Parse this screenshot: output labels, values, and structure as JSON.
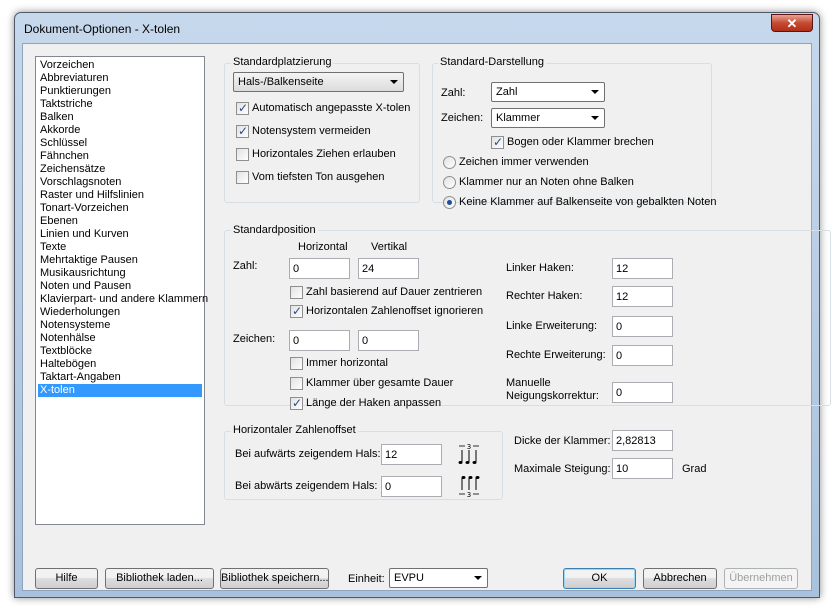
{
  "window": {
    "title": "Dokument-Optionen - X-tolen",
    "close_glyph": "✕"
  },
  "sidebar": {
    "selected": "X-tolen",
    "items": [
      "Vorzeichen",
      "Abbreviaturen",
      "Punktierungen",
      "Taktstriche",
      "Balken",
      "Akkorde",
      "Schlüssel",
      "Fähnchen",
      "Zeichensätze",
      "Vorschlagsnoten",
      "Raster und Hilfslinien",
      "Tonart-Vorzeichen",
      "Ebenen",
      "Linien und Kurven",
      "Texte",
      "Mehrtaktige Pausen",
      "Musikausrichtung",
      "Noten und Pausen",
      "Klavierpart- und andere Klammern",
      "Wiederholungen",
      "Notensysteme",
      "Notenhälse",
      "Textblöcke",
      "Haltebögen",
      "Taktart-Angaben",
      "X-tolen"
    ]
  },
  "standardplatzierung": {
    "label": "Standardplatzierung",
    "dropdown_value": "Hals-/Balkenseite",
    "checks": [
      {
        "label": "Automatisch angepasste X-tolen",
        "checked": true
      },
      {
        "label": "Notensystem vermeiden",
        "checked": true
      },
      {
        "label": "Horizontales Ziehen erlauben",
        "checked": false
      },
      {
        "label": "Vom tiefsten Ton ausgehen",
        "checked": false
      }
    ]
  },
  "standard_darstellung": {
    "label": "Standard-Darstellung",
    "zahl_label": "Zahl:",
    "zahl_value": "Zahl",
    "zeichen_label": "Zeichen:",
    "zeichen_value": "Klammer",
    "bogen_check": {
      "label": "Bogen oder Klammer brechen",
      "checked": true
    },
    "radios": [
      {
        "label": "Zeichen immer verwenden",
        "selected": false
      },
      {
        "label": "Klammer nur an Noten ohne Balken",
        "selected": false
      },
      {
        "label": "Keine Klammer auf Balkenseite von gebalkten Noten",
        "selected": true
      }
    ]
  },
  "standardposition": {
    "label": "Standardposition",
    "col_horizontal": "Horizontal",
    "col_vertikal": "Vertikal",
    "zahl_label": "Zahl:",
    "zahl_h": "0",
    "zahl_v": "24",
    "zahl_checks": [
      {
        "label": "Zahl basierend auf Dauer zentrieren",
        "checked": false
      },
      {
        "label": "Horizontalen Zahlenoffset ignorieren",
        "checked": true
      }
    ],
    "zeichen_label": "Zeichen:",
    "zeichen_h": "0",
    "zeichen_v": "0",
    "zeichen_checks": [
      {
        "label": "Immer horizontal",
        "checked": false
      },
      {
        "label": "Klammer über gesamte Dauer",
        "checked": false
      },
      {
        "label": "Länge der Haken anpassen",
        "checked": true
      }
    ],
    "right_fields": [
      {
        "label": "Linker Haken:",
        "value": "12"
      },
      {
        "label": "Rechter Haken:",
        "value": "12"
      },
      {
        "label": "Linke Erweiterung:",
        "value": "0"
      },
      {
        "label": "Rechte Erweiterung:",
        "value": "0"
      }
    ],
    "neigung_label_1": "Manuelle",
    "neigung_label_2": "Neigungskorrektur:",
    "neigung_value": "0"
  },
  "zahlenoffset": {
    "label": "Horizontaler Zahlenoffset",
    "aufwaerts_label": "Bei aufwärts zeigendem Hals:",
    "aufwaerts_value": "12",
    "abwaerts_label": "Bei abwärts zeigendem Hals:",
    "abwaerts_value": "0"
  },
  "klammer": {
    "dicke_label": "Dicke der Klammer:",
    "dicke_value": "2,82813",
    "steigung_label": "Maximale Steigung:",
    "steigung_value": "10",
    "steigung_unit": "Grad"
  },
  "footer": {
    "hilfe": "Hilfe",
    "bibliothek_laden": "Bibliothek laden...",
    "bibliothek_speichern": "Bibliothek speichern...",
    "einheit_label": "Einheit:",
    "einheit_value": "EVPU",
    "ok": "OK",
    "abbrechen": "Abbrechen",
    "uebernehmen": "Übernehmen"
  },
  "icons": {
    "up": "triplet-stem-up-icon",
    "down": "triplet-stem-down-icon"
  }
}
